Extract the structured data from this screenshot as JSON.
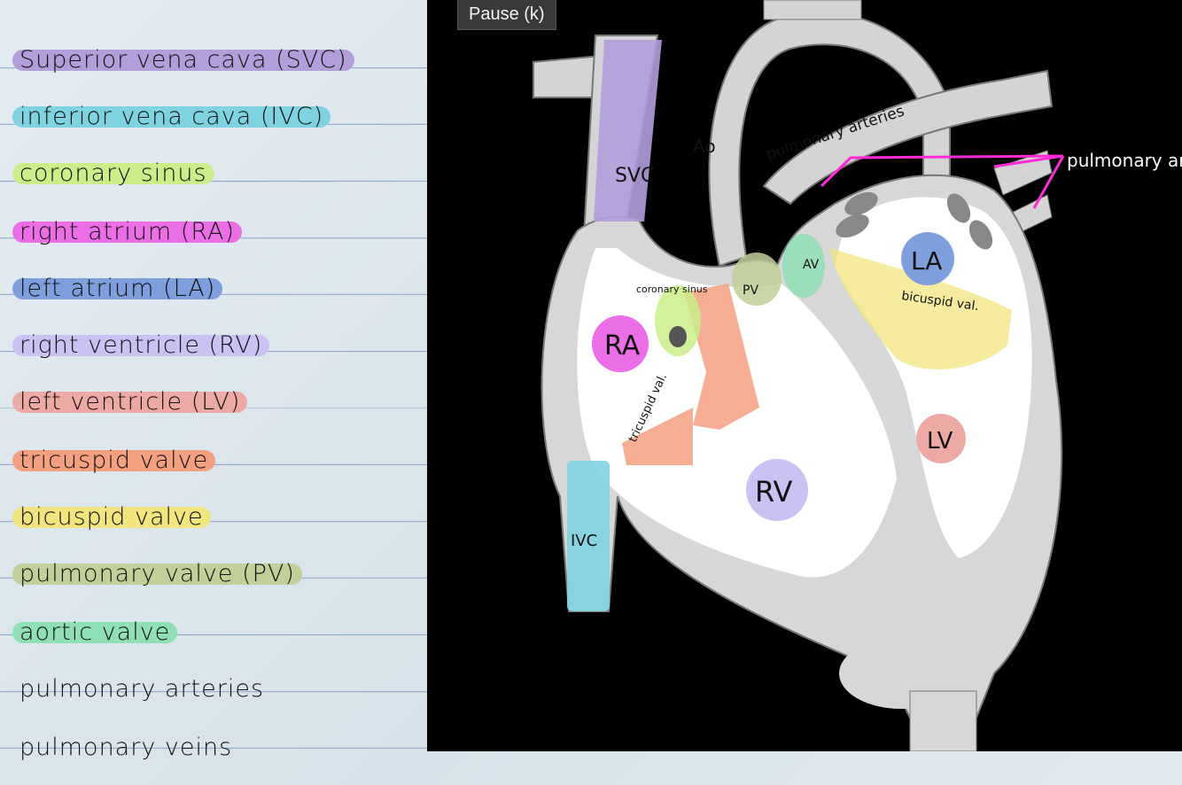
{
  "pause_button": {
    "label": "Pause (k)"
  },
  "legend": [
    {
      "text": "Superior vena cava (SVC)",
      "color": "#b39ddb"
    },
    {
      "text": "inferior vena cava (IVC)",
      "color": "#7fd3e0"
    },
    {
      "text": "coronary sinus",
      "color": "#c9ee8a"
    },
    {
      "text": "right atrium (RA)",
      "color": "#ec6ee6"
    },
    {
      "text": "left atrium (LA)",
      "color": "#7f9fdc"
    },
    {
      "text": "right ventricle (RV)",
      "color": "#c9c2f2"
    },
    {
      "text": "left ventricle (LV)",
      "color": "#eda9a4"
    },
    {
      "text": "tricuspid valve",
      "color": "#f3a080"
    },
    {
      "text": "bicuspid valve",
      "color": "#f2e47e"
    },
    {
      "text": "pulmonary valve (PV)",
      "color": "#c1cf98"
    },
    {
      "text": "aortic valve",
      "color": "#8fe0b4"
    },
    {
      "text": "pulmonary arteries",
      "color": ""
    },
    {
      "text": "pulmonary veins",
      "color": ""
    }
  ],
  "diagram": {
    "labels": {
      "svc": "SVC",
      "ivc": "IVC",
      "ao": "Ao",
      "pulmonary_arteries": "pulmonary arteries",
      "pulmonary_arteries_right": "pulmonary arteries",
      "coronary_sinus": "coronary sinus",
      "ra": "RA",
      "la": "LA",
      "rv": "RV",
      "lv": "LV",
      "pv": "PV",
      "av": "AV",
      "bicuspid": "bicuspid val.",
      "tricuspid": "tricuspid val."
    },
    "colors": {
      "svc": "#b39ddb",
      "ivc": "#7fd3e0",
      "ra": "#ec6ee6",
      "la": "#7f9fdc",
      "rv": "#c9c2f2",
      "lv": "#eda9a4",
      "tricuspid": "#f3a080",
      "bicuspid": "#f2e47e",
      "pv": "#c1cf98",
      "av": "#8fe0b4",
      "coronary_sinus": "#c9ee8a",
      "arrow": "#ff2bd6"
    }
  }
}
